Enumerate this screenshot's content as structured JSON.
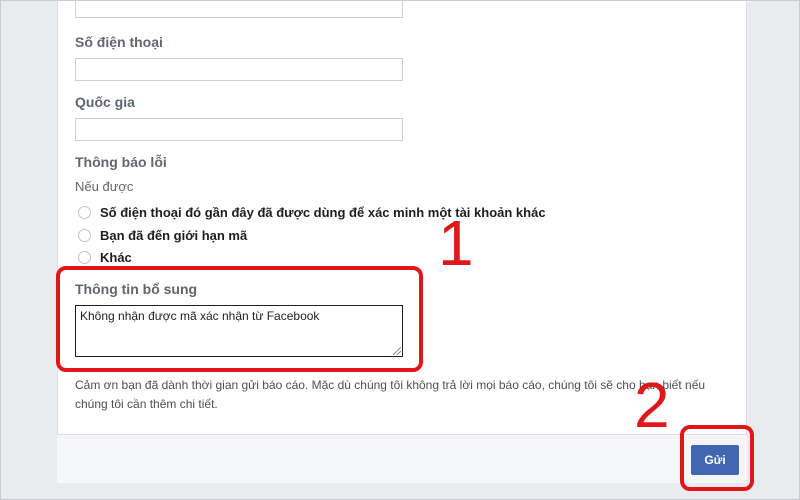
{
  "form": {
    "phone_label": "Số điện thoại",
    "country_label": "Quốc gia",
    "error_label": "Thông báo lỗi",
    "if_applicable": "Nếu được",
    "options": [
      "Số điện thoại đó gần đây đã được dùng để xác minh một tài khoản khác",
      "Bạn đã đến giới hạn mã",
      "Khác"
    ],
    "additional_label": "Thông tin bổ sung",
    "additional_value": "Không nhận được mã xác nhận từ Facebook",
    "note": "Cảm ơn bạn đã dành thời gian gửi báo cáo. Mặc dù chúng tôi không trả lời mọi báo cáo, chúng tôi sẽ cho bạn biết nếu chúng tôi cần thêm chi tiết.",
    "submit_label": "Gửi"
  },
  "annotations": {
    "step1": "1",
    "step2": "2",
    "color": "#e0161b"
  },
  "colors": {
    "button": "#4267b2",
    "background": "#e9ebee"
  }
}
